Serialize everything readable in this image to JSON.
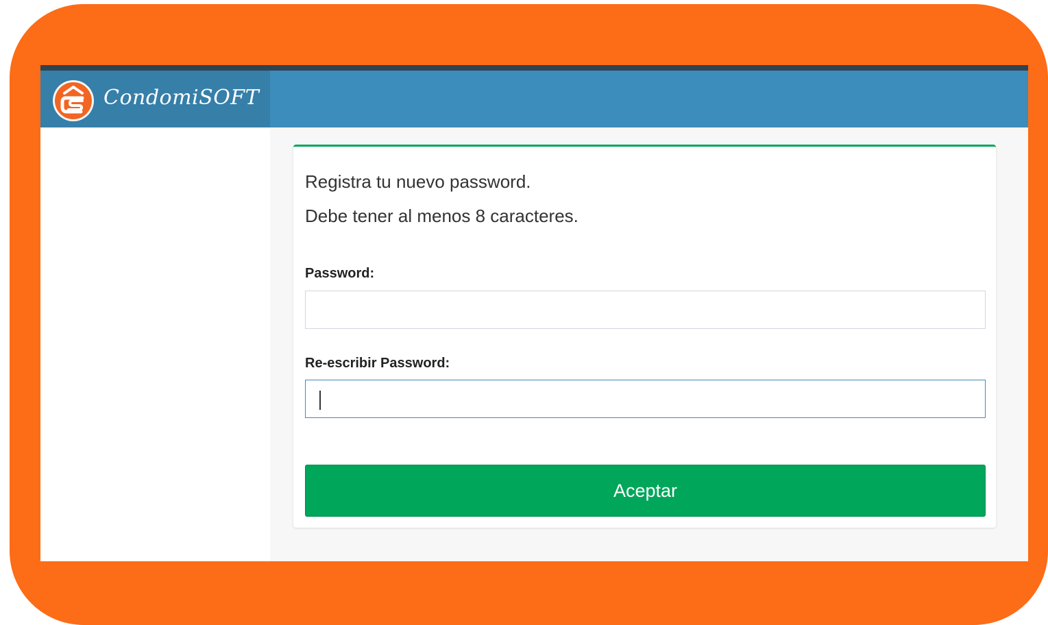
{
  "brand": {
    "name": "CondomiSOFT",
    "logo_icon": "condomisoft-cs-logo-icon"
  },
  "form": {
    "message_line1": "Registra tu nuevo password.",
    "message_line2": "Debe tener al menos 8 caracteres.",
    "password_label": "Password:",
    "password_value": "",
    "repeat_label": "Re-escribir Password:",
    "repeat_value": "",
    "submit_label": "Aceptar"
  },
  "colors": {
    "frame": "#fd6c16",
    "navbar": "#3c8dbc",
    "brand_bg": "#367fa9",
    "logo_circle": "#f26522",
    "accept_button": "#00a65a"
  }
}
